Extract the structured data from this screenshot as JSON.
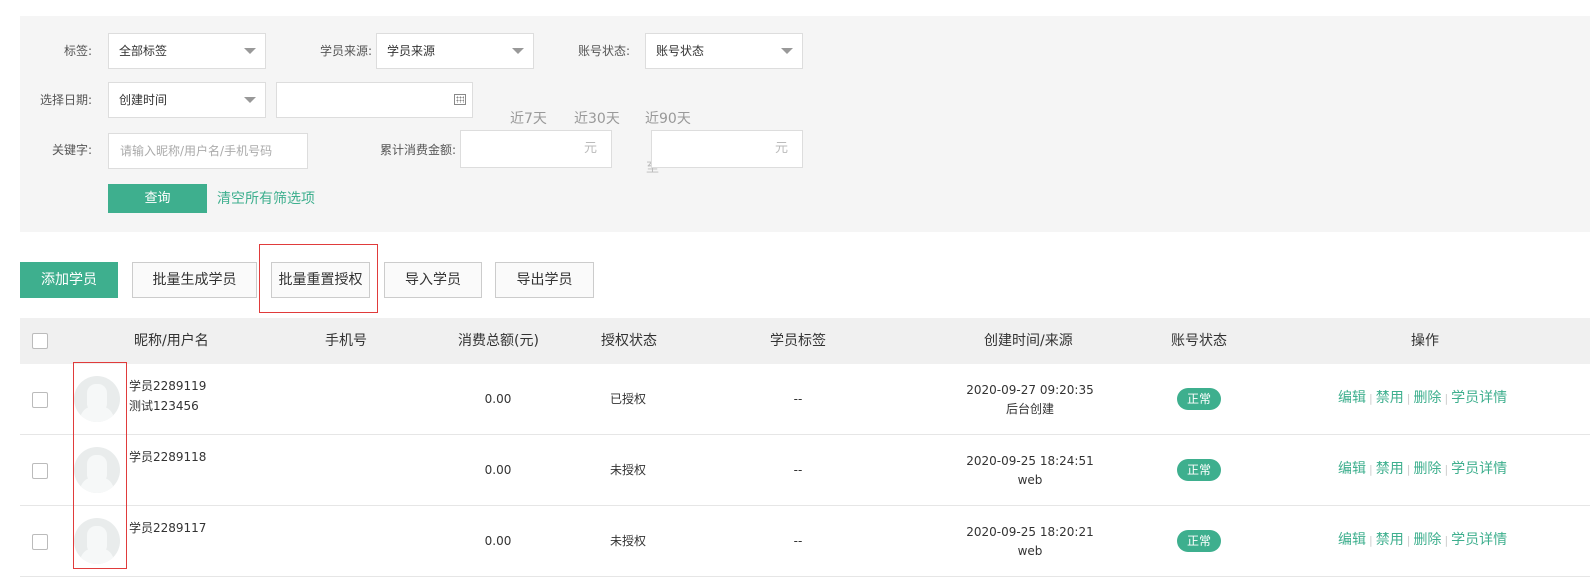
{
  "filters": {
    "tag_label": "标签:",
    "tag_value": "全部标签",
    "source_label": "学员来源:",
    "source_value": "学员来源",
    "status_label": "账号状态:",
    "status_value": "账号状态",
    "date_label": "选择日期:",
    "date_type_value": "创建时间",
    "date_range_value": "",
    "quick_ranges": [
      "近7天",
      "近30天",
      "近90天"
    ],
    "keyword_label": "关键字:",
    "keyword_placeholder": "请输入昵称/用户名/手机号码",
    "amount_label": "累计消费金额:",
    "amount_unit": "元",
    "amount_to": "至",
    "query_button": "查询",
    "clear_link": "清空所有筛选项"
  },
  "toolbar": {
    "add": "添加学员",
    "batch_generate": "批量生成学员",
    "batch_reset_auth": "批量重置授权",
    "import": "导入学员",
    "export": "导出学员"
  },
  "table": {
    "headers": [
      "昵称/用户名",
      "手机号",
      "消费总额(元)",
      "授权状态",
      "学员标签",
      "创建时间/来源",
      "账号状态",
      "操作"
    ],
    "actions": [
      "编辑",
      "禁用",
      "删除",
      "学员详情"
    ],
    "rows": [
      {
        "nickname": "学员2289119",
        "username": "测试123456",
        "phone": "",
        "amount": "0.00",
        "auth": "已授权",
        "tags": "--",
        "created": "2020-09-27 09:20:35",
        "source": "后台创建",
        "status": "正常"
      },
      {
        "nickname": "学员2289118",
        "username": "",
        "phone": "",
        "amount": "0.00",
        "auth": "未授权",
        "tags": "--",
        "created": "2020-09-25 18:24:51",
        "source": "web",
        "status": "正常"
      },
      {
        "nickname": "学员2289117",
        "username": "",
        "phone": "",
        "amount": "0.00",
        "auth": "未授权",
        "tags": "--",
        "created": "2020-09-25 18:20:21",
        "source": "web",
        "status": "正常"
      }
    ]
  },
  "colors": {
    "accent": "#3eaf8e",
    "highlight_box": "#e03b3b"
  }
}
